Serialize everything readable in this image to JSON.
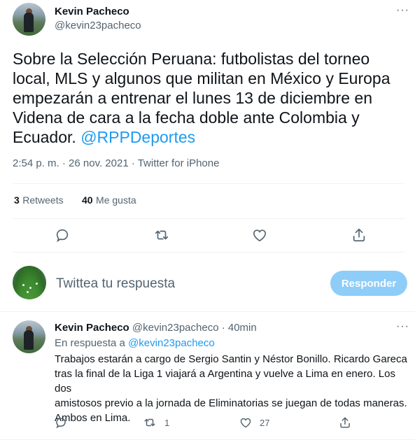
{
  "tweet": {
    "author_name": "Kevin Pacheco",
    "author_handle": "@kevin23pacheco",
    "more_label": "···",
    "text_line1": "Sobre la Selección Peruana: futbolistas del torneo",
    "text_line2": "local, MLS y algunos que militan en México y Europa",
    "text_line3": "empezarán a entrenar el lunes 13 de diciembre en",
    "text_line4": "Videna de cara a la fecha doble ante Colombia y",
    "text_line5_prefix": "Ecuador. ",
    "mention": "@RPPDeportes",
    "timestamp": "2:54 p. m. · 26 nov. 2021 · Twitter for iPhone",
    "retweets_count": "3",
    "retweets_label": "Retweets",
    "likes_count": "40",
    "likes_label": "Me gusta"
  },
  "compose": {
    "placeholder": "Twittea tu respuesta",
    "button_label": "Responder"
  },
  "reply": {
    "author_name": "Kevin Pacheco",
    "author_handle": "@kevin23pacheco",
    "time": "· 40min",
    "more_label": "···",
    "in_reply_prefix": "En respuesta a",
    "in_reply_handle": "@kevin23pacheco",
    "line1": "Trabajos estarán a cargo de Sergio Santin y Néstor Bonillo. Ricardo Gareca",
    "line2": "tras la final de la Liga 1 viajará a Argentina y vuelve a Lima en enero. Los dos",
    "line3": "amistosos previo a la jornada de Eliminatorias se juegan de todas maneras.",
    "line4": "Ambos en Lima.",
    "retweet_count": "1",
    "like_count": "27"
  },
  "colors": {
    "accent": "#1d9bf0",
    "button_disabled": "#8ecdf8",
    "secondary_text": "#536471"
  }
}
